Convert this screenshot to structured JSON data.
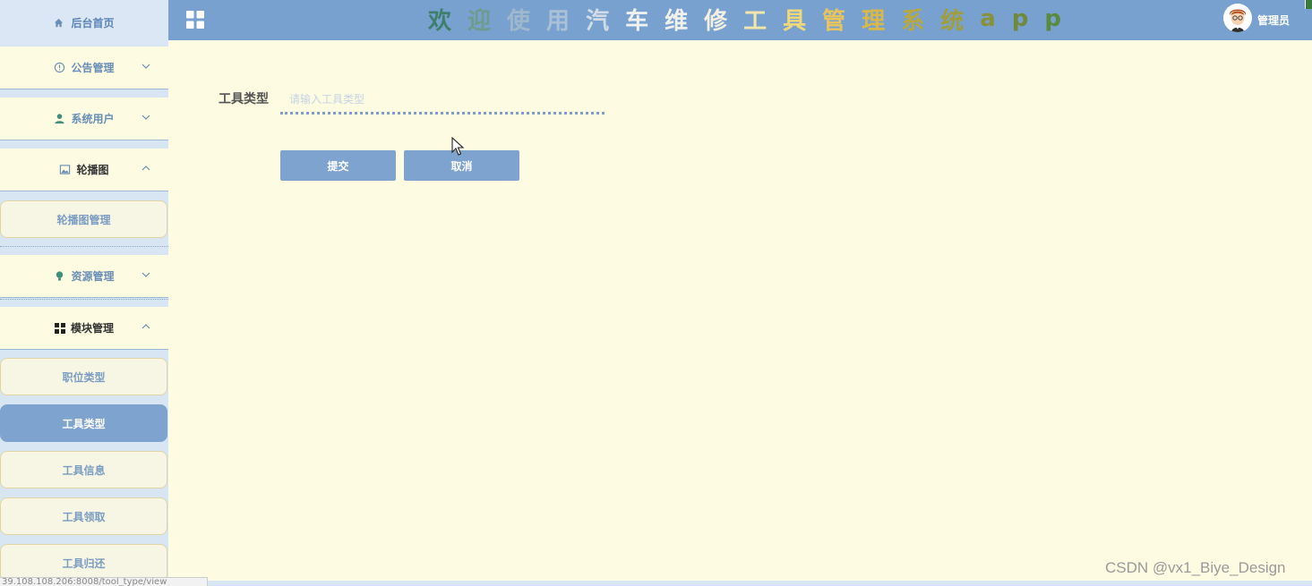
{
  "sidebar": {
    "home": {
      "label": "后台首页",
      "icon": "home-icon"
    },
    "groups": [
      {
        "label": "公告管理",
        "icon": "info-circle-icon",
        "expanded": false
      },
      {
        "label": "系统用户",
        "icon": "user-icon",
        "expanded": false
      },
      {
        "label": "轮播图",
        "icon": "image-icon",
        "expanded": true,
        "items": [
          {
            "label": "轮播图管理"
          }
        ]
      },
      {
        "label": "资源管理",
        "icon": "lightbulb-icon",
        "expanded": false
      },
      {
        "label": "模块管理",
        "icon": "grid-icon",
        "expanded": true,
        "items": [
          {
            "label": "职位类型"
          },
          {
            "label": "工具类型",
            "active": true
          },
          {
            "label": "工具信息"
          },
          {
            "label": "工具领取"
          },
          {
            "label": "工具归还"
          }
        ]
      }
    ]
  },
  "header": {
    "title_chars": [
      "欢",
      "迎",
      "使",
      "用",
      "汽",
      "车",
      "维",
      "修",
      "工",
      "具",
      "管",
      "理",
      "系",
      "统",
      "a",
      "p",
      "p"
    ],
    "title_colors": [
      "#3f7f6e",
      "#6f9b8e",
      "#9fb8cc",
      "#a9c0d8",
      "#d2dce6",
      "#eef1f0",
      "#f1f1ec",
      "#f2f0e0",
      "#f3e6a8",
      "#f0d878",
      "#e8c55c",
      "#d8b848",
      "#b8a840",
      "#a09d3c",
      "#88903a",
      "#6e8a3a",
      "#5a8a3e"
    ],
    "admin_label": "管理员"
  },
  "form": {
    "label": "工具类型",
    "placeholder": "请输入工具类型",
    "value": "",
    "submit_label": "提交",
    "cancel_label": "取消"
  },
  "statusbar": {
    "url": "39.108.108.206:8008/tool_type/view"
  },
  "watermark": "CSDN @vx1_Biye_Design",
  "colors": {
    "header_bg": "#79a1cf",
    "sidebar_bg": "#d8e6f4",
    "page_bg": "#fdfbe2",
    "button_bg": "#7fa3cf"
  }
}
